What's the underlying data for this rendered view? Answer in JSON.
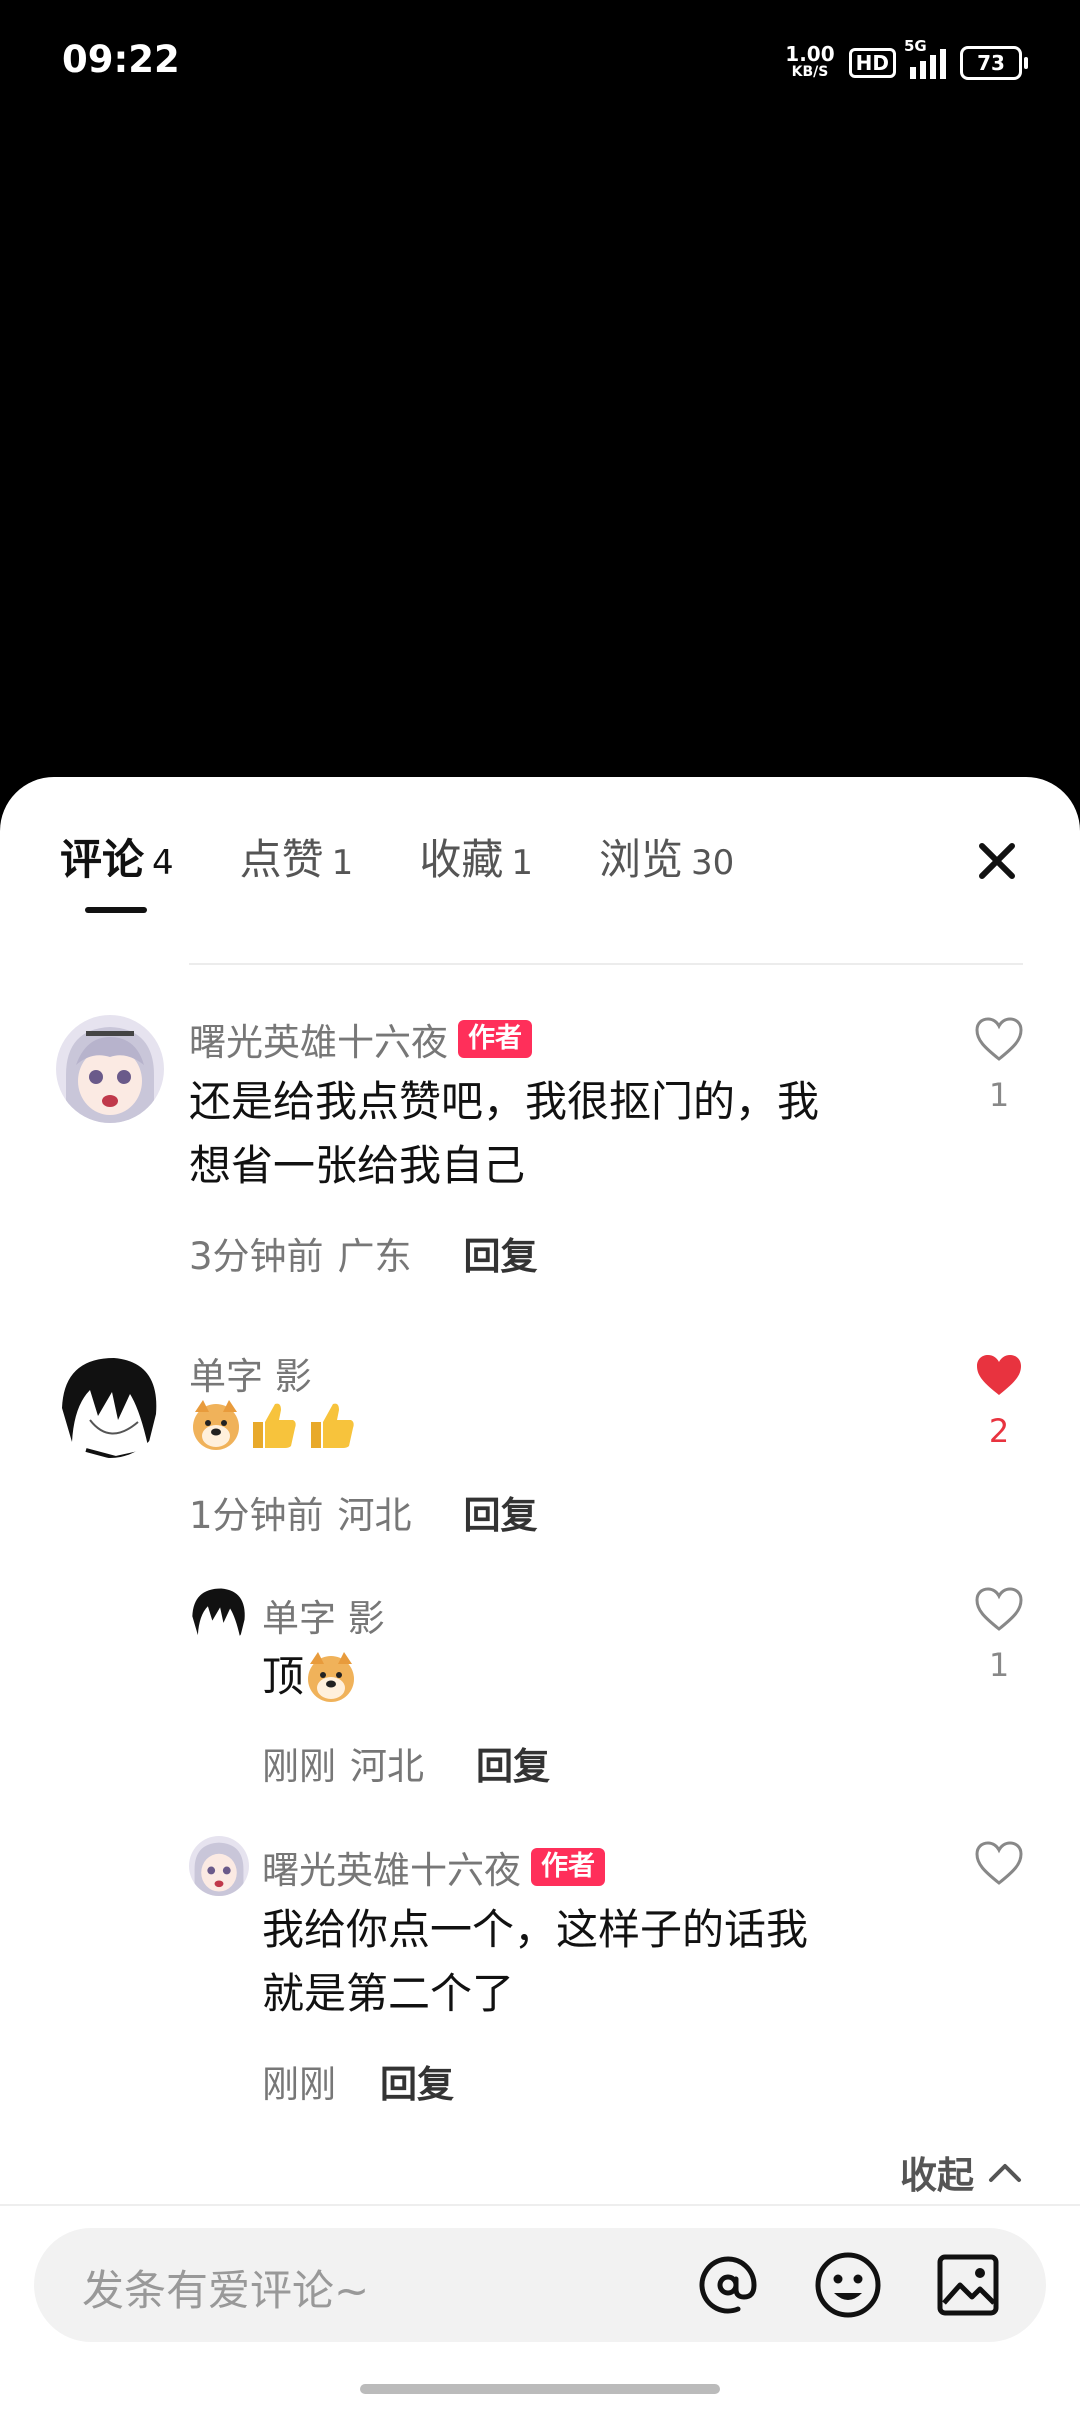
{
  "status": {
    "time": "09:22",
    "net_speed": "1.00",
    "net_unit": "KB/S",
    "hd": "HD",
    "network": "5G",
    "battery": "73"
  },
  "tabs": [
    {
      "label": "评论",
      "count": "4",
      "active": true
    },
    {
      "label": "点赞",
      "count": "1"
    },
    {
      "label": "收藏",
      "count": "1"
    },
    {
      "label": "浏览",
      "count": "30"
    }
  ],
  "comments": [
    {
      "name": "曙光英雄十六夜",
      "badge": "作者",
      "text_line1": "还是给我点赞吧，我很抠门的，我",
      "text_line2": "想省一张给我自己",
      "time": "3分钟前",
      "location": "广东",
      "reply": "回复",
      "likes": "1",
      "liked": false
    },
    {
      "name": "单字 影",
      "text": "",
      "time": "1分钟前",
      "location": "河北",
      "reply": "回复",
      "likes": "2",
      "liked": true
    }
  ],
  "replies": [
    {
      "name": "单字 影",
      "text": "顶",
      "time": "刚刚",
      "location": "河北",
      "reply": "回复",
      "likes": "1",
      "liked": false
    },
    {
      "name": "曙光英雄十六夜",
      "badge": "作者",
      "text_line1": "我给你点一个，这样子的话我",
      "text_line2": "就是第二个了",
      "time": "刚刚",
      "reply": "回复",
      "likes": "",
      "liked": false
    }
  ],
  "collapse_label": "收起",
  "input": {
    "placeholder": "发条有爱评论~"
  },
  "colors": {
    "accent_red": "#e8333f",
    "badge_pink": "#ff2f5a"
  },
  "icons": [
    "close-icon",
    "heart-icon",
    "heart-filled-icon",
    "at-icon",
    "emoji-icon",
    "image-icon",
    "chevron-up-icon",
    "doge-emoji",
    "thumbs-up-emoji"
  ]
}
